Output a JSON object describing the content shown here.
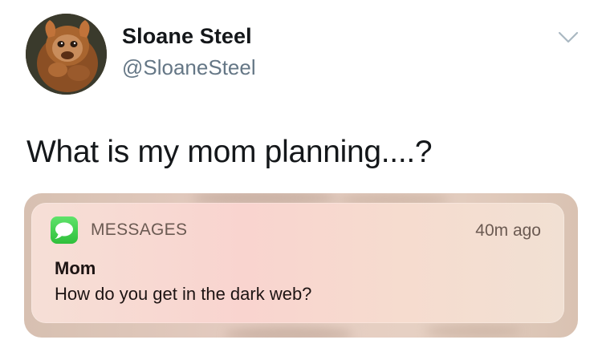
{
  "tweet": {
    "author": {
      "display_name": "Sloane Steel",
      "handle": "@SloaneSteel",
      "avatar_icon": "orangutan-avatar"
    },
    "menu_icon": "chevron-down-icon",
    "text": "What is my mom planning....?"
  },
  "notification": {
    "app_icon": "messages-bubble-icon",
    "app_name": "MESSAGES",
    "time_ago": "40m ago",
    "sender": "Mom",
    "message": "How do you get in the dark web?"
  },
  "colors": {
    "name_text": "#14171a",
    "handle_text": "#657786",
    "messages_green": "#34c759",
    "notification_bg": "#f9d4cf"
  }
}
